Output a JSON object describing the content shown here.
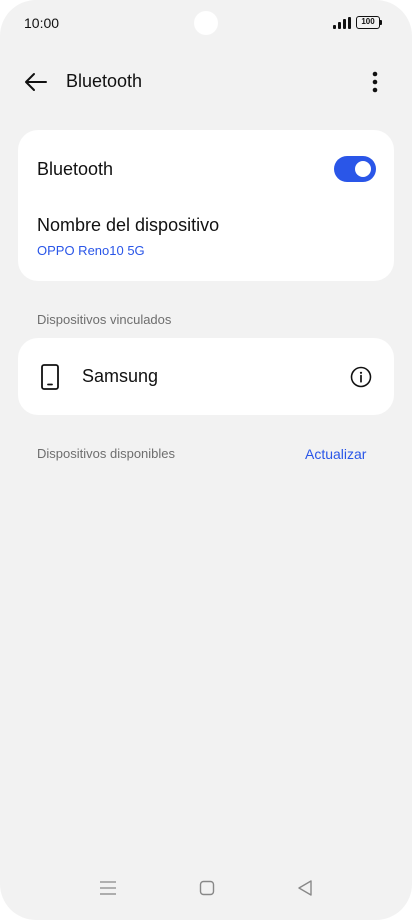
{
  "status_bar": {
    "time": "10:00",
    "battery": "100",
    "icons": [
      "camera-cutout",
      "signal-icon",
      "battery-icon"
    ]
  },
  "app_bar": {
    "title": "Bluetooth",
    "icons": [
      "arrow-left-icon",
      "more-vertical-icon"
    ]
  },
  "bluetooth_card": {
    "toggle_label": "Bluetooth",
    "toggle_on": true,
    "device_name_label": "Nombre del dispositivo",
    "device_name_value": "OPPO Reno10 5G"
  },
  "paired_section": {
    "label": "Dispositivos vinculados",
    "devices": [
      {
        "name": "Samsung",
        "icon": "smartphone-icon",
        "action_icon": "info-icon"
      }
    ]
  },
  "available_section": {
    "label": "Dispositivos disponibles",
    "refresh_label": "Actualizar"
  },
  "nav_bar": {
    "icons": [
      "menu-icon",
      "home-square-icon",
      "back-triangle-icon"
    ]
  },
  "colors": {
    "accent": "#2a56e8",
    "background": "#f2f2f2",
    "card": "#ffffff",
    "secondary_text": "#6e6e6e"
  }
}
